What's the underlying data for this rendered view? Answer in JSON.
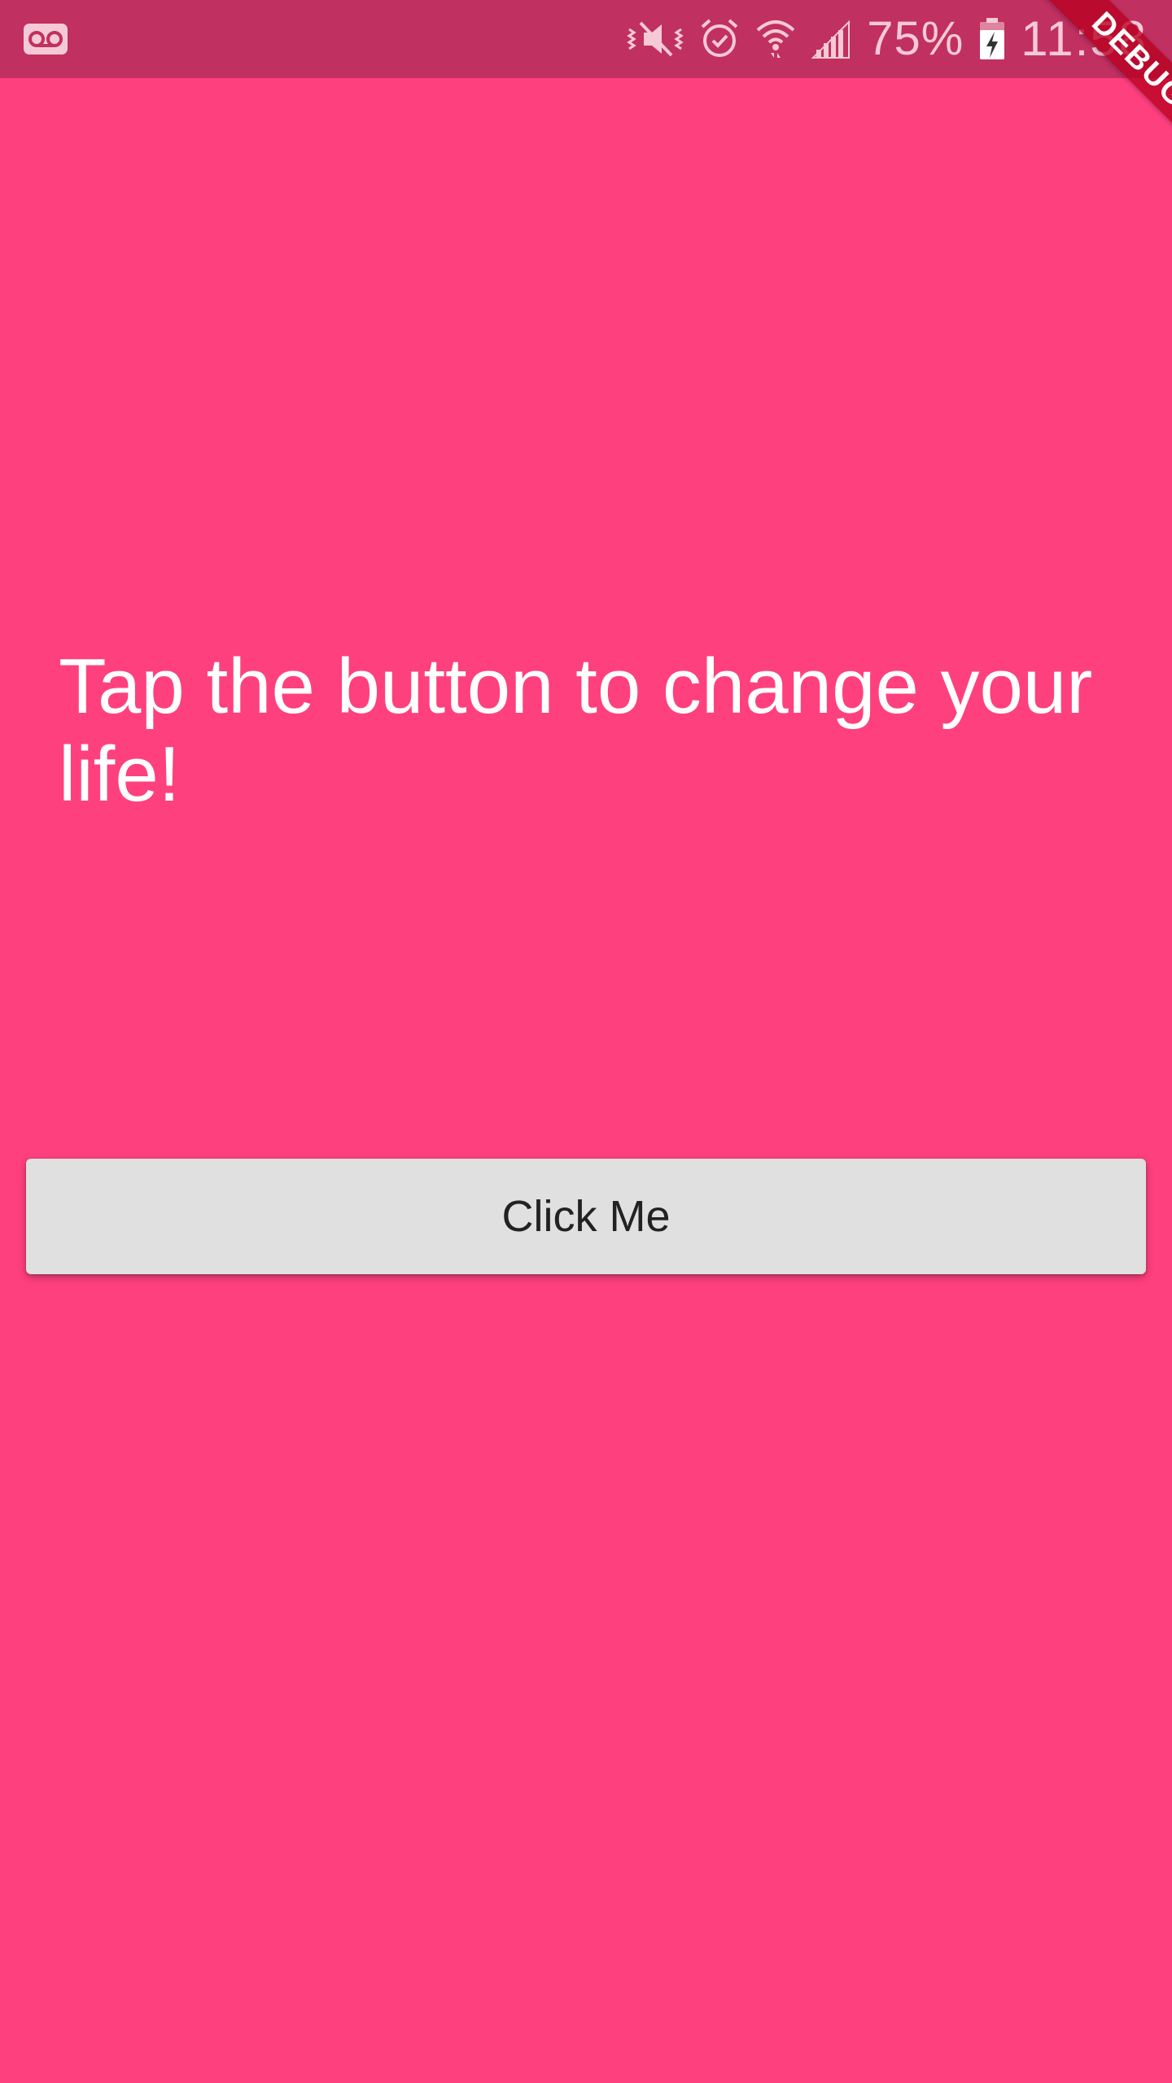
{
  "status_bar": {
    "battery_percent": "75%",
    "time": "11:58",
    "icons": [
      "voicemail-icon",
      "vibrate-mute-icon",
      "alarm-icon",
      "wifi-icon",
      "signal-icon",
      "battery-charging-icon"
    ]
  },
  "debug_banner": {
    "label": "DEBUG"
  },
  "main": {
    "headline": "Tap the button to change your life!",
    "button_label": "Click Me"
  },
  "colors": {
    "background": "#ff407e",
    "status_bar": "#c03060",
    "button": "#e0e0e0",
    "debug_ribbon": "#b80020"
  }
}
